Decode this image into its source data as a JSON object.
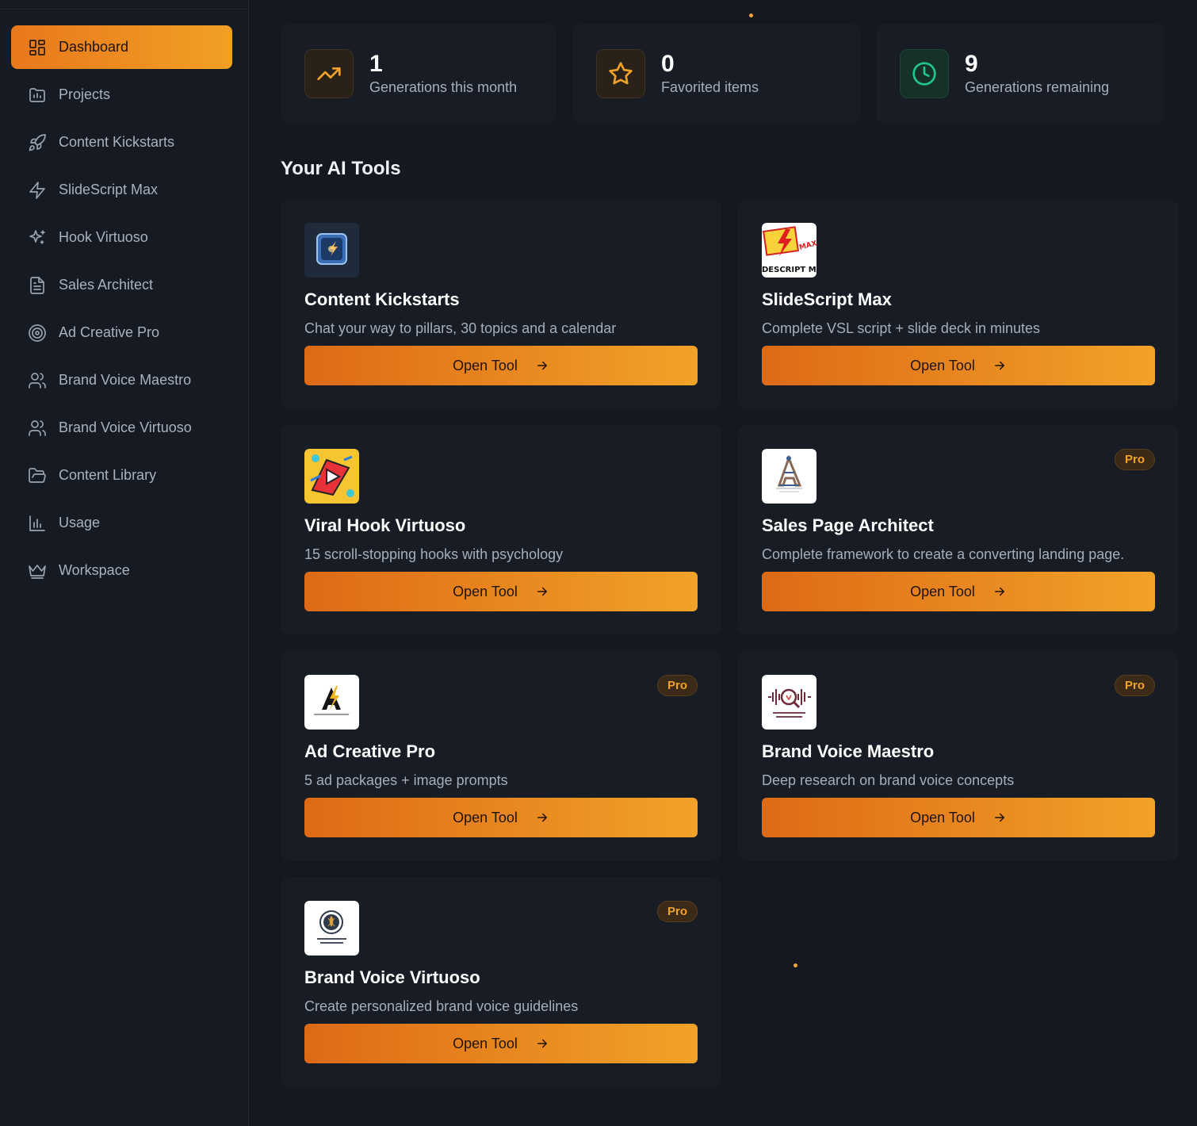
{
  "sidebar": {
    "items": [
      {
        "label": "Dashboard",
        "icon": "dashboard-grid-icon",
        "active": true
      },
      {
        "label": "Projects",
        "icon": "folder-chart-icon"
      },
      {
        "label": "Content Kickstarts",
        "icon": "rocket-icon"
      },
      {
        "label": "SlideScript Max",
        "icon": "lightning-icon"
      },
      {
        "label": "Hook Virtuoso",
        "icon": "sparkles-icon"
      },
      {
        "label": "Sales Architect",
        "icon": "document-icon"
      },
      {
        "label": "Ad Creative Pro",
        "icon": "target-icon"
      },
      {
        "label": "Brand Voice Maestro",
        "icon": "users-icon"
      },
      {
        "label": "Brand Voice Virtuoso",
        "icon": "users-icon"
      },
      {
        "label": "Content Library",
        "icon": "folder-open-icon"
      },
      {
        "label": "Usage",
        "icon": "bar-chart-icon"
      },
      {
        "label": "Workspace",
        "icon": "crown-icon"
      }
    ]
  },
  "stats": [
    {
      "value": "1",
      "label": "Generations this month",
      "icon": "trending-up-icon",
      "color": "#f2a228"
    },
    {
      "value": "0",
      "label": "Favorited items",
      "icon": "star-icon",
      "color": "#f2a228"
    },
    {
      "value": "9",
      "label": "Generations remaining",
      "icon": "clock-icon",
      "color": "#22c58b"
    }
  ],
  "tools_section": {
    "title": "Your AI Tools"
  },
  "tools": [
    {
      "title": "Content Kickstarts",
      "description": "Chat your way to pillars, 30 topics and a calendar",
      "button": "Open Tool",
      "pro": "",
      "logo": "content-kickstarts-logo"
    },
    {
      "title": "SlideScript Max",
      "description": "Complete VSL script + slide deck in minutes",
      "button": "Open Tool",
      "pro": "",
      "logo": "slidescript-max-logo",
      "logo_text": "DESCRIPT M"
    },
    {
      "title": "Viral Hook Virtuoso",
      "description": "15 scroll-stopping hooks with psychology",
      "button": "Open Tool",
      "pro": "",
      "logo": "viral-hook-logo"
    },
    {
      "title": "Sales Page Architect",
      "description": "Complete framework to create a converting landing page.",
      "button": "Open Tool",
      "pro": "Pro",
      "logo": "sales-page-architect-logo"
    },
    {
      "title": "Ad Creative Pro",
      "description": "5 ad packages + image prompts",
      "button": "Open Tool",
      "pro": "Pro",
      "logo": "ad-creative-pro-logo"
    },
    {
      "title": "Brand Voice Maestro",
      "description": "Deep research on brand voice concepts",
      "button": "Open Tool",
      "pro": "Pro",
      "logo": "brand-voice-maestro-logo"
    },
    {
      "title": "Brand Voice Virtuoso",
      "description": "Create personalized brand voice guidelines",
      "button": "Open Tool",
      "pro": "Pro",
      "logo": "brand-voice-virtuoso-logo"
    }
  ],
  "colors": {
    "accent": "#f2a228",
    "accent_dark": "#dd6a16",
    "background": "#141820",
    "card": "#181c25"
  }
}
